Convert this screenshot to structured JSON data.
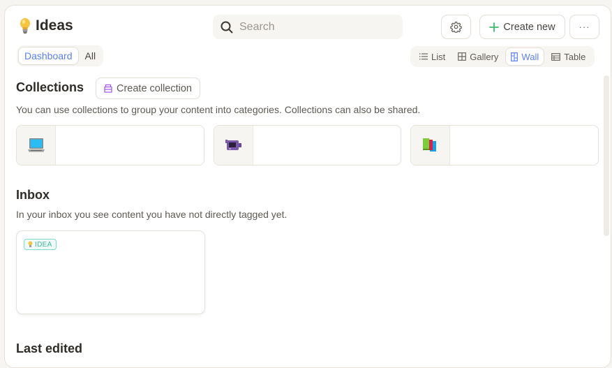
{
  "header": {
    "title": "Ideas",
    "title_icon": "lightbulb-icon",
    "tabs": [
      {
        "label": "Dashboard",
        "active": true
      },
      {
        "label": "All",
        "active": false
      }
    ],
    "search": {
      "placeholder": "Search",
      "value": ""
    },
    "settings_icon": "gear-icon",
    "create_new_label": "Create new",
    "more_label": "···",
    "views": [
      {
        "label": "List",
        "icon": "list-icon",
        "active": false
      },
      {
        "label": "Gallery",
        "icon": "gallery-grid-icon",
        "active": false
      },
      {
        "label": "Wall",
        "icon": "wall-icon",
        "active": true
      },
      {
        "label": "Table",
        "icon": "table-icon",
        "active": false
      }
    ]
  },
  "collections": {
    "title": "Collections",
    "create_label": "Create collection",
    "description": "You can use collections to group your content into categories. Collections can also be shared.",
    "items": [
      {
        "icon": "laptop-icon",
        "name": "",
        "subtitle": ""
      },
      {
        "icon": "video-camera-icon",
        "name": "",
        "subtitle": ""
      },
      {
        "icon": "books-icon",
        "name": "",
        "subtitle": ""
      }
    ]
  },
  "inbox": {
    "title": "Inbox",
    "description": "In your inbox you see content you have not directly tagged yet.",
    "cards": [
      {
        "tag": "IDEA",
        "title": "",
        "body": ""
      }
    ]
  },
  "last_edited": {
    "title": "Last edited"
  },
  "colors": {
    "accent": "#5b7ff0",
    "create_plus": "#3dbb6e",
    "tag_idea": "#3fb59c",
    "collection_icon": "#a35de8"
  }
}
